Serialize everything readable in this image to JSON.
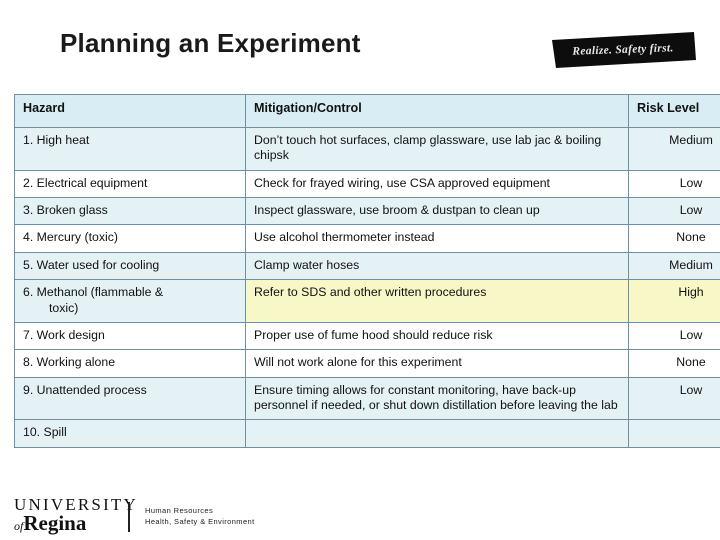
{
  "slide": {
    "title": "Planning an Experiment",
    "badge_text": "Realize. Safety first."
  },
  "table": {
    "headers": {
      "hazard": "Hazard",
      "mitigation": "Mitigation/Control",
      "risk": "Risk Level"
    },
    "rows": [
      {
        "hazard": "1. High heat",
        "mitigation": "Don’t touch hot surfaces, clamp glassware, use lab jac & boiling chipsk",
        "risk": "Medium"
      },
      {
        "hazard": "2. Electrical equipment",
        "mitigation": "Check for frayed wiring, use CSA approved equipment",
        "risk": "Low"
      },
      {
        "hazard": "3. Broken glass",
        "mitigation": "Inspect glassware, use broom & dustpan to clean up",
        "risk": "Low"
      },
      {
        "hazard": "4. Mercury (toxic)",
        "mitigation": "Use alcohol thermometer instead",
        "risk": "None"
      },
      {
        "hazard": "5. Water used for cooling",
        "mitigation": "Clamp water hoses",
        "risk": "Medium"
      },
      {
        "hazard": "6. Methanol (flammable &",
        "hazard_line2": "toxic)",
        "mitigation": "Refer to SDS and other written procedures",
        "risk": "High"
      },
      {
        "hazard": "7. Work design",
        "mitigation": "Proper use of fume hood should reduce risk",
        "risk": "Low"
      },
      {
        "hazard": "8. Working alone",
        "mitigation": "Will not work alone for this experiment",
        "risk": "None"
      },
      {
        "hazard": "9. Unattended process",
        "mitigation": "Ensure timing allows for constant monitoring, have back-up personnel if needed, or shut down distillation before leaving the lab",
        "risk": "Low"
      },
      {
        "hazard": "10. Spill",
        "mitigation": "",
        "risk": ""
      }
    ]
  },
  "footer": {
    "logo_line1": "UNIVERSITY",
    "logo_of": "of",
    "logo_line2": "Regina",
    "unit_line1": "Human Resources",
    "unit_line2": "Health, Safety & Environment"
  },
  "colors": {
    "header_fill": "#d9eef4",
    "row_shade": "#e4f1f5",
    "highlight": "#f7f7c8",
    "border": "#6f8fa3",
    "badge_fill": "#0d0d0d"
  }
}
